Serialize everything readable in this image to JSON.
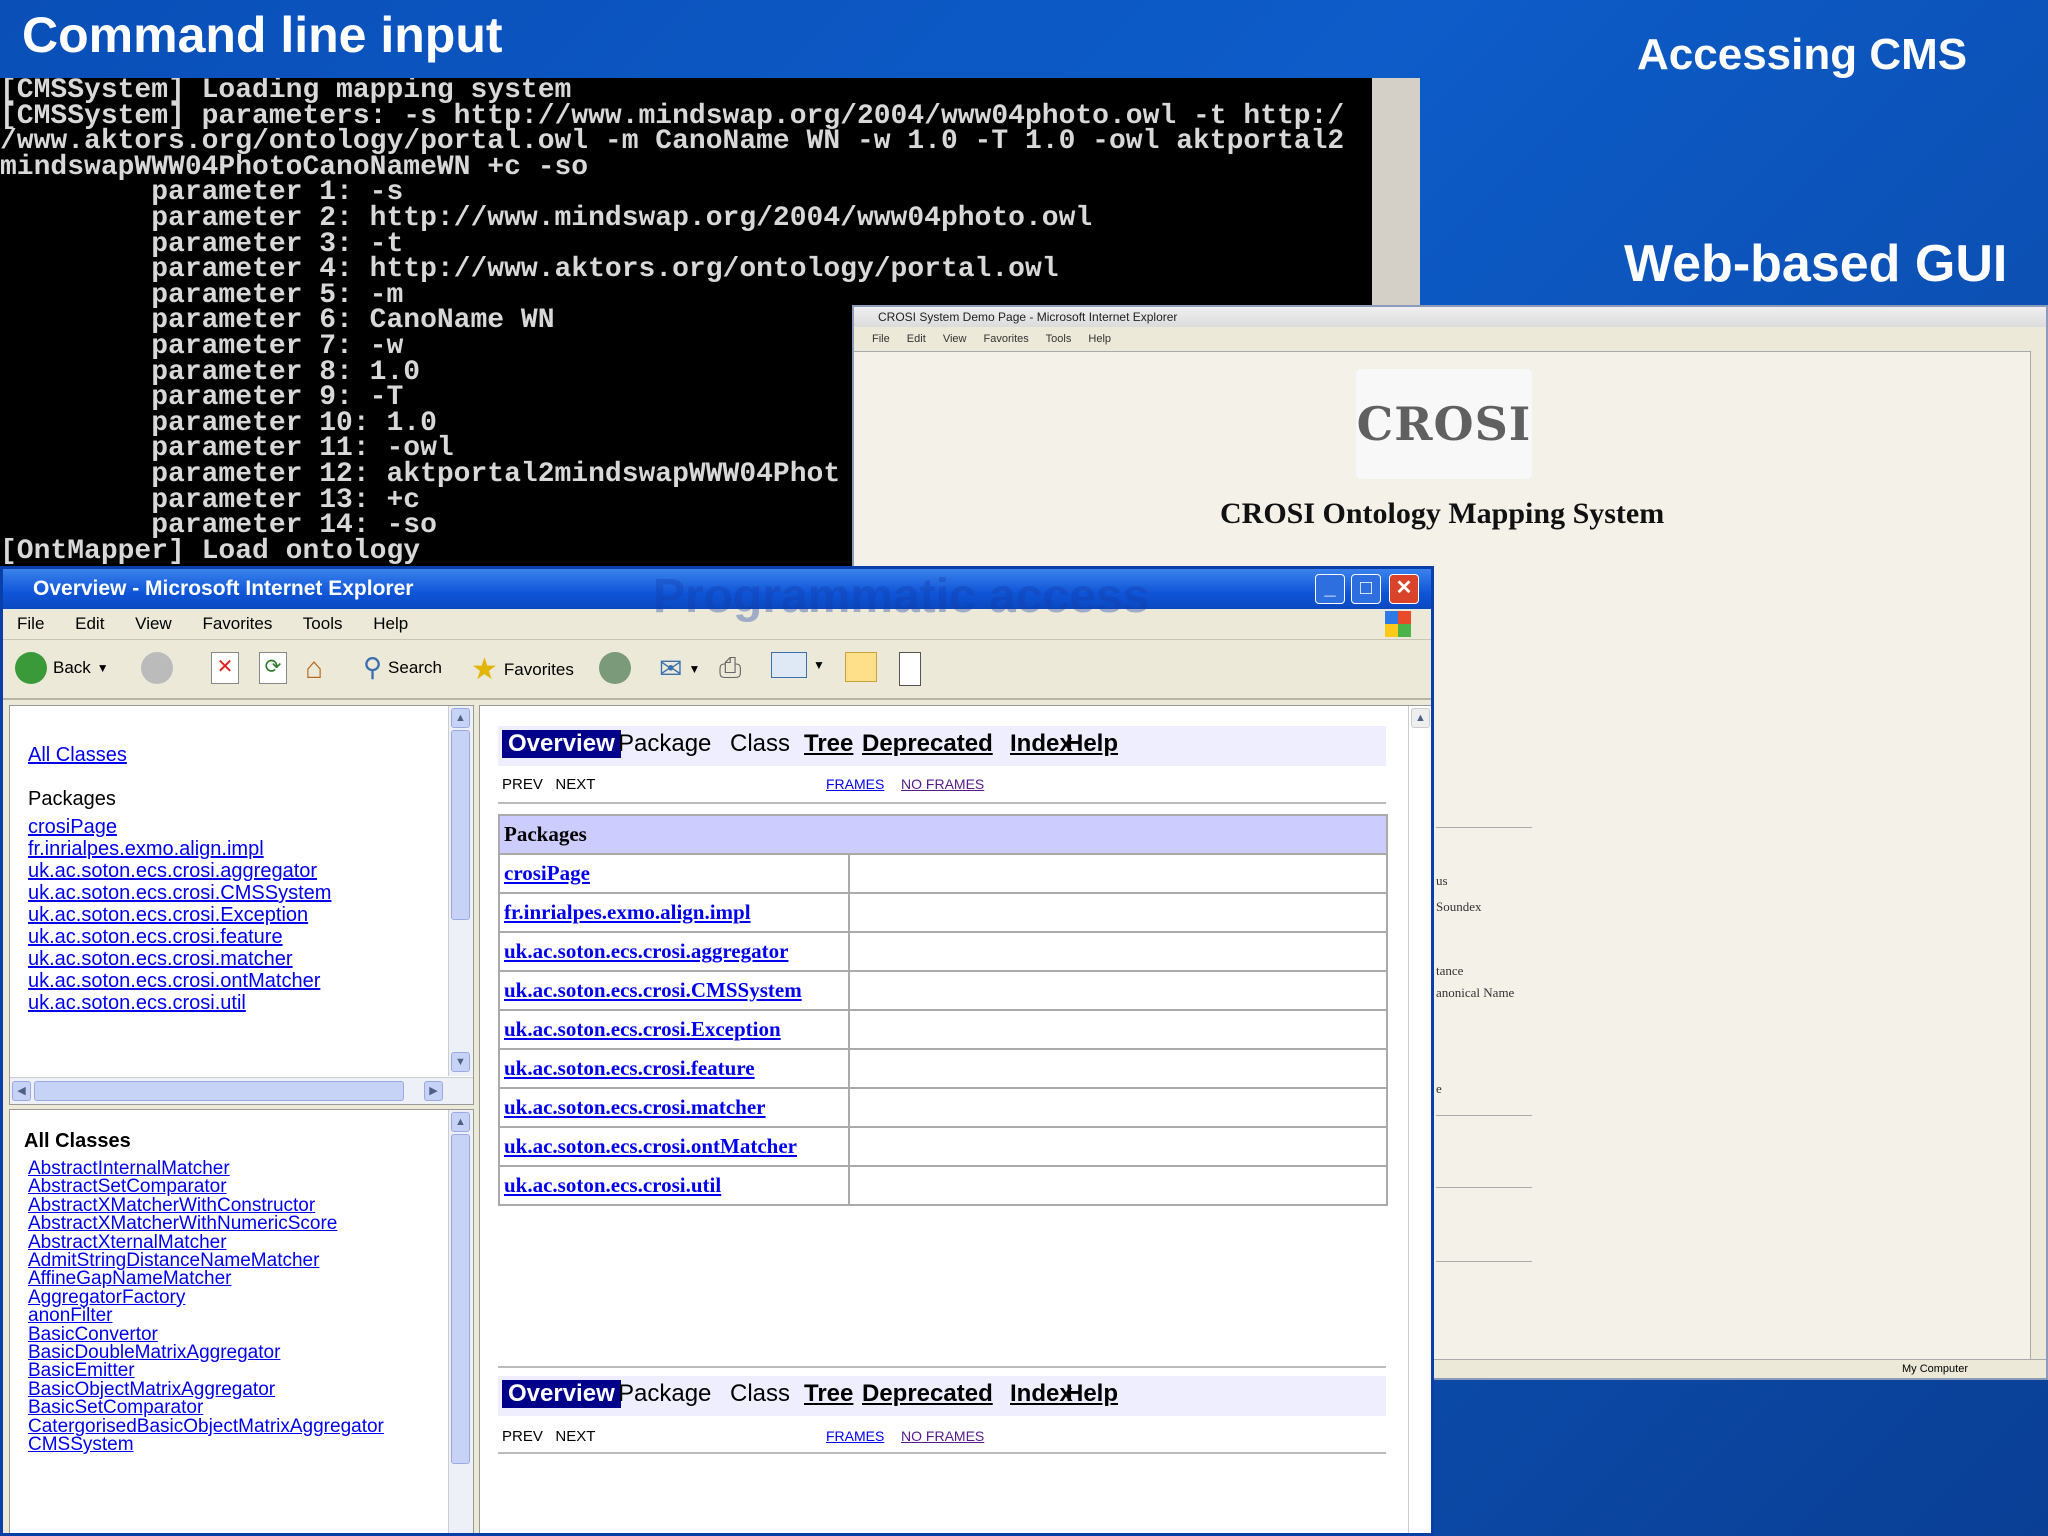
{
  "slide": {
    "title_left": "Command line input",
    "title_right": "Accessing CMS",
    "web_label": "Web-based GUI",
    "ghost_text": "Programmatic access"
  },
  "console": {
    "lines": [
      "[CMSSystem] Loading mapping system",
      "[CMSSystem] parameters: -s http://www.mindswap.org/2004/www04photo.owl -t http:/",
      "/www.aktors.org/ontology/portal.owl -m CanoName WN -w 1.0 -T 1.0 -owl aktportal2",
      "mindswapWWW04PhotoCanoNameWN +c -so",
      "         parameter 1: -s",
      "         parameter 2: http://www.mindswap.org/2004/www04photo.owl",
      "         parameter 3: -t",
      "         parameter 4: http://www.aktors.org/ontology/portal.owl",
      "         parameter 5: -m",
      "         parameter 6: CanoName WN",
      "         parameter 7: -w",
      "         parameter 8: 1.0",
      "         parameter 9: -T",
      "         parameter 10: 1.0",
      "         parameter 11: -owl",
      "         parameter 12: aktportal2mindswapWWW04Phot",
      "         parameter 13: +c",
      "         parameter 14: -so",
      "[OntMapper] Load ontology"
    ]
  },
  "crosi_window": {
    "title": "CROSI System Demo Page - Microsoft Internet Explorer",
    "menu": [
      "File",
      "Edit",
      "View",
      "Favorites",
      "Tools",
      "Help"
    ],
    "logo_text": "CROSI",
    "heading": "CROSI Ontology Mapping System",
    "fragments": [
      "us",
      "Soundex",
      "tance",
      "anonical Name",
      "e"
    ],
    "status": "My Computer"
  },
  "ie_window": {
    "title": "Overview - Microsoft Internet Explorer",
    "menu": [
      "File",
      "Edit",
      "View",
      "Favorites",
      "Tools",
      "Help"
    ],
    "toolbar": {
      "back": "Back",
      "search": "Search",
      "favorites": "Favorites"
    },
    "left_top": {
      "all_classes": "All Classes",
      "packages_heading": "Packages",
      "packages": [
        "crosiPage",
        "fr.inrialpes.exmo.align.impl",
        "uk.ac.soton.ecs.crosi.aggregator",
        "uk.ac.soton.ecs.crosi.CMSSystem",
        "uk.ac.soton.ecs.crosi.Exception",
        "uk.ac.soton.ecs.crosi.feature",
        "uk.ac.soton.ecs.crosi.matcher",
        "uk.ac.soton.ecs.crosi.ontMatcher",
        "uk.ac.soton.ecs.crosi.util"
      ]
    },
    "left_bottom": {
      "heading": "All Classes",
      "classes": [
        "AbstractInternalMatcher",
        "AbstractSetComparator",
        "AbstractXMatcherWithConstructor",
        "AbstractXMatcherWithNumericScore",
        "AbstractXternalMatcher",
        "AdmitStringDistanceNameMatcher",
        "AffineGapNameMatcher",
        "AggregatorFactory",
        "anonFilter",
        "BasicConvertor",
        "BasicDoubleMatrixAggregator",
        "BasicEmitter",
        "BasicObjectMatrixAggregator",
        "BasicSetComparator",
        "CatergorisedBasicObjectMatrixAggregator",
        "CMSSystem"
      ]
    },
    "right": {
      "nav": {
        "overview": "Overview",
        "package": "Package",
        "class": "Class",
        "tree": "Tree",
        "deprecated": "Deprecated",
        "index": "Index",
        "help": "Help"
      },
      "subnav": {
        "prev": "PREV",
        "next": "NEXT",
        "frames": "FRAMES",
        "no_frames": "NO FRAMES"
      },
      "packages_heading": "Packages",
      "packages": [
        "crosiPage",
        "fr.inrialpes.exmo.align.impl",
        "uk.ac.soton.ecs.crosi.aggregator",
        "uk.ac.soton.ecs.crosi.CMSSystem",
        "uk.ac.soton.ecs.crosi.Exception",
        "uk.ac.soton.ecs.crosi.feature",
        "uk.ac.soton.ecs.crosi.matcher",
        "uk.ac.soton.ecs.crosi.ontMatcher",
        "uk.ac.soton.ecs.crosi.util"
      ]
    }
  },
  "colors": {
    "background": "#0a4fb8",
    "console_bg": "#000000",
    "xp_title": "#0f55d8",
    "javadoc_header": "#ccccff",
    "javadoc_nav_active": "#00008b"
  }
}
